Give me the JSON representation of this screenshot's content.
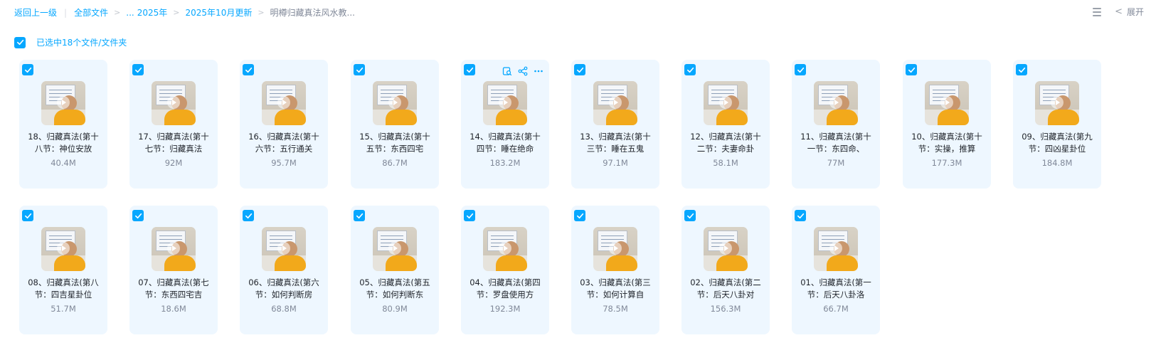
{
  "breadcrumb": {
    "back": "返回上一级",
    "root": "全部文件",
    "ellipsis": "...",
    "year": "2025年",
    "month": "2025年10月更新",
    "current": "明樽归藏真法风水教..."
  },
  "toolbar": {
    "expand_label": "展开"
  },
  "selection": {
    "label": "已选中18个文件/文件夹"
  },
  "colors": {
    "accent": "#06a7ff",
    "card_bg": "#eef7ff"
  },
  "files": [
    {
      "line1": "18、归藏真法(第十",
      "line2": "八节：神位安放",
      "size": "40.4M"
    },
    {
      "line1": "17、归藏真法(第十",
      "line2": "七节：归藏真法",
      "size": "92M"
    },
    {
      "line1": "16、归藏真法(第十",
      "line2": "六节：五行通关",
      "size": "95.7M"
    },
    {
      "line1": "15、归藏真法(第十",
      "line2": "五节：东西四宅",
      "size": "86.7M"
    },
    {
      "line1": "14、归藏真法(第十",
      "line2": "四节：睡在绝命",
      "size": "183.2M"
    },
    {
      "line1": "13、归藏真法(第十",
      "line2": "三节：睡在五鬼",
      "size": "97.1M"
    },
    {
      "line1": "12、归藏真法(第十",
      "line2": "二节：夫妻命卦",
      "size": "58.1M"
    },
    {
      "line1": "11、归藏真法(第十",
      "line2": "一节：东四命、",
      "size": "77M"
    },
    {
      "line1": "10、归藏真法(第十",
      "line2": "节：实操，推算",
      "size": "177.3M"
    },
    {
      "line1": "09、归藏真法(第九",
      "line2": "节：四凶星卦位",
      "size": "184.8M"
    },
    {
      "line1": "08、归藏真法(第八",
      "line2": "节：四吉星卦位",
      "size": "51.7M"
    },
    {
      "line1": "07、归藏真法(第七",
      "line2": "节：东西四宅吉",
      "size": "18.6M"
    },
    {
      "line1": "06、归藏真法(第六",
      "line2": "节：如何判断房",
      "size": "68.8M"
    },
    {
      "line1": "05、归藏真法(第五",
      "line2": "节：如何判断东",
      "size": "80.9M"
    },
    {
      "line1": "04、归藏真法(第四",
      "line2": "节：罗盘使用方",
      "size": "192.3M"
    },
    {
      "line1": "03、归藏真法(第三",
      "line2": "节：如何计算自",
      "size": "78.5M"
    },
    {
      "line1": "02、归藏真法(第二",
      "line2": "节：后天八卦对",
      "size": "156.3M"
    },
    {
      "line1": "01、归藏真法(第一",
      "line2": "节：后天八卦洛",
      "size": "66.7M"
    }
  ],
  "icons": {
    "checkbox": "check-icon",
    "hover_tools": [
      "preview-icon",
      "share-icon",
      "more-icon"
    ],
    "list_view": "list-view-icon",
    "expand": "chevron-left-icon"
  }
}
